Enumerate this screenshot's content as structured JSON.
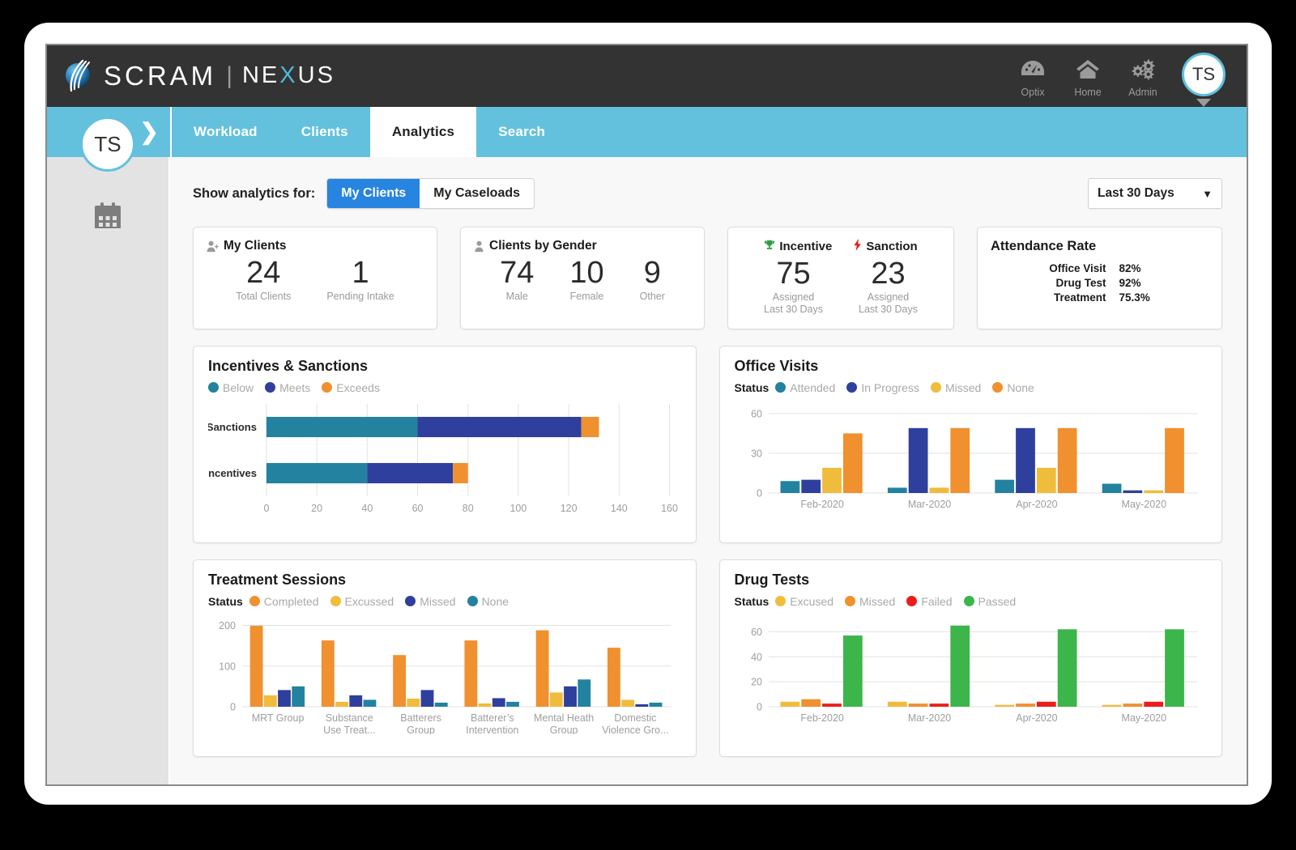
{
  "brand": {
    "scram": "SCRAM",
    "separator": "|",
    "nexus_pre": "NE",
    "nexus_x": "X",
    "nexus_post": "US"
  },
  "header": {
    "actions": [
      {
        "label": "Optix",
        "icon": "gauge-icon"
      },
      {
        "label": "Home",
        "icon": "home-icon"
      },
      {
        "label": "Admin",
        "icon": "gears-icon"
      }
    ],
    "avatar_initials": "TS"
  },
  "nav": {
    "expand_chevron": "❯",
    "tabs": [
      {
        "label": "Workload",
        "active": false
      },
      {
        "label": "Clients",
        "active": false
      },
      {
        "label": "Analytics",
        "active": true
      },
      {
        "label": "Search",
        "active": false
      }
    ]
  },
  "sidebar": {
    "avatar_initials": "TS",
    "icon": "calendar-icon"
  },
  "controls": {
    "label": "Show analytics for:",
    "segments": [
      {
        "label": "My Clients",
        "active": true
      },
      {
        "label": "My Caseloads",
        "active": false
      }
    ],
    "date_range": {
      "value": "Last 30 Days",
      "caret": "▼"
    }
  },
  "kpis": {
    "my_clients": {
      "title": "My Clients",
      "icon": "user-plus-icon",
      "stats": [
        {
          "value": "24",
          "label": "Total Clients"
        },
        {
          "value": "1",
          "label": "Pending Intake"
        }
      ]
    },
    "clients_by_gender": {
      "title": "Clients by Gender",
      "icon": "user-icon",
      "stats": [
        {
          "value": "74",
          "label": "Male"
        },
        {
          "value": "10",
          "label": "Female"
        },
        {
          "value": "9",
          "label": "Other"
        }
      ]
    },
    "incentive_sanction": {
      "heads": [
        {
          "title": "Incentive",
          "icon": "trophy-icon",
          "color": "#2e9e3f"
        },
        {
          "title": "Sanction",
          "icon": "lightning-icon",
          "color": "#e51b1b"
        }
      ],
      "stats": [
        {
          "value": "75",
          "label_line1": "Assigned",
          "label_line2": "Last 30 Days"
        },
        {
          "value": "23",
          "label_line1": "Assigned",
          "label_line2": "Last 30 Days"
        }
      ]
    },
    "attendance_rate": {
      "title": "Attendance Rate",
      "rows": [
        {
          "key": "Office Visit",
          "value": "82%"
        },
        {
          "key": "Drug Test",
          "value": "92%"
        },
        {
          "key": "Treatment",
          "value": "75.3%"
        }
      ]
    }
  },
  "chart_data": [
    {
      "id": "incentives-sanctions",
      "type": "bar",
      "orientation": "horizontal",
      "stacked": true,
      "title": "Incentives & Sanctions",
      "legend_prefix": "",
      "legend_position": "top",
      "grid": true,
      "categories": [
        "Sanctions",
        "Incentives"
      ],
      "series": [
        {
          "name": "Below",
          "color": "#22829f",
          "values": [
            60,
            40
          ]
        },
        {
          "name": "Meets",
          "color": "#2e3f9e",
          "values": [
            65,
            34
          ]
        },
        {
          "name": "Exceeds",
          "color": "#f0902f",
          "values": [
            7,
            6
          ]
        }
      ],
      "xlabel": "",
      "ylabel": "",
      "xlim": [
        0,
        160
      ],
      "xticks": [
        0,
        20,
        40,
        60,
        80,
        100,
        120,
        140,
        160
      ]
    },
    {
      "id": "office-visits",
      "type": "bar",
      "orientation": "vertical",
      "stacked": false,
      "title": "Office Visits",
      "legend_prefix": "Status",
      "legend_position": "top",
      "grid": true,
      "categories": [
        "Feb-2020",
        "Mar-2020",
        "Apr-2020",
        "May-2020"
      ],
      "series": [
        {
          "name": "Attended",
          "color": "#22829f",
          "values": [
            9,
            4,
            10,
            7
          ]
        },
        {
          "name": "In Progress",
          "color": "#2e3f9e",
          "values": [
            10,
            49,
            49,
            2
          ]
        },
        {
          "name": "Missed",
          "color": "#f0bc3c",
          "values": [
            19,
            4,
            19,
            2
          ]
        },
        {
          "name": "None",
          "color": "#f0902f",
          "values": [
            45,
            49,
            49,
            49
          ]
        }
      ],
      "xlabel": "",
      "ylabel": "",
      "ylim": [
        0,
        66
      ],
      "yticks": [
        0,
        30,
        60
      ]
    },
    {
      "id": "treatment-sessions",
      "type": "bar",
      "orientation": "vertical",
      "stacked": false,
      "title": "Treatment Sessions",
      "legend_prefix": "Status",
      "legend_position": "top",
      "grid": true,
      "categories": [
        "MRT Group",
        "Substance\nUse Treat...",
        "Batterers\nGroup",
        "Batterer’s\nIntervention",
        "Mental Heath\nGroup",
        "Domestic\nViolence Gro..."
      ],
      "series": [
        {
          "name": "Completed",
          "color": "#f0902f",
          "values": [
            199,
            163,
            127,
            163,
            188,
            145
          ]
        },
        {
          "name": "Excussed",
          "color": "#f0bc3c",
          "values": [
            28,
            12,
            20,
            8,
            35,
            17
          ]
        },
        {
          "name": "Missed",
          "color": "#2e3f9e",
          "values": [
            41,
            28,
            41,
            21,
            50,
            6
          ]
        },
        {
          "name": "None",
          "color": "#22829f",
          "values": [
            50,
            17,
            10,
            12,
            67,
            10
          ]
        }
      ],
      "xlabel": "",
      "ylabel": "",
      "ylim": [
        0,
        215
      ],
      "yticks": [
        0,
        100,
        200
      ]
    },
    {
      "id": "drug-tests",
      "type": "bar",
      "orientation": "vertical",
      "stacked": false,
      "title": "Drug Tests",
      "legend_prefix": "Status",
      "legend_position": "top",
      "grid": true,
      "categories": [
        "Feb-2020",
        "Mar-2020",
        "Apr-2020",
        "May-2020"
      ],
      "series": [
        {
          "name": "Excused",
          "color": "#f0bc3c",
          "values": [
            4,
            4,
            1.5,
            1.5
          ]
        },
        {
          "name": "Missed",
          "color": "#f0902f",
          "values": [
            6,
            2.5,
            2.5,
            2.5
          ]
        },
        {
          "name": "Failed",
          "color": "#ee1c1c",
          "values": [
            2.5,
            2.5,
            4,
            4
          ]
        },
        {
          "name": "Passed",
          "color": "#3cb54a",
          "values": [
            57,
            65,
            62,
            62
          ]
        }
      ],
      "xlabel": "",
      "ylabel": "",
      "ylim": [
        0,
        70
      ],
      "yticks": [
        0,
        20,
        40,
        60
      ]
    }
  ]
}
